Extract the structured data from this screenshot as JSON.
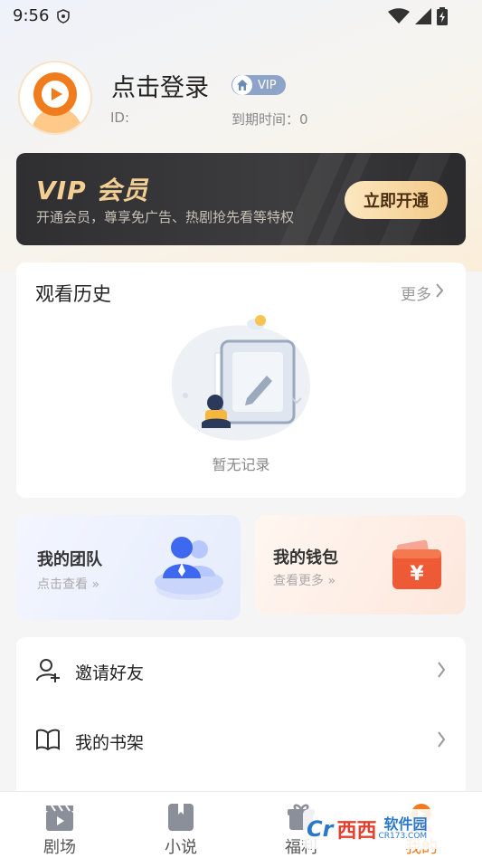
{
  "status_bar": {
    "time": "9:56"
  },
  "profile": {
    "login_text": "点击登录",
    "vip_badge": "VIP",
    "id_label": "ID:",
    "expire_label": "到期时间：0"
  },
  "vip_card": {
    "title": "VIP 会员",
    "subtitle": "开通会员，尊享免广告、热剧抢先看等特权",
    "button": "立即开通"
  },
  "history": {
    "title": "观看历史",
    "more": "更多",
    "empty_text": "暂无记录"
  },
  "team": {
    "title": "我的团队",
    "subtitle": "点击查看 »"
  },
  "wallet": {
    "title": "我的钱包",
    "subtitle": "查看更多 »"
  },
  "menu": {
    "items": [
      {
        "label": "邀请好友",
        "icon": "add-user-icon"
      },
      {
        "label": "我的书架",
        "icon": "book-icon"
      }
    ]
  },
  "tabs": [
    {
      "label": "剧场",
      "icon": "clapperboard-icon",
      "active": false
    },
    {
      "label": "小说",
      "icon": "book-icon",
      "active": false
    },
    {
      "label": "福利",
      "icon": "gift-icon",
      "active": false
    },
    {
      "label": "我的",
      "icon": "profile-icon",
      "active": true
    }
  ],
  "colors": {
    "accent": "#f07c1e",
    "vip_gold": "#f3cf94",
    "vip_dark": "#2f2f32",
    "badge_blue": "#8da3c7"
  },
  "watermark": {
    "logo": "Cr",
    "name": "西西",
    "soft": "软件园",
    "url": "CR173.COM"
  }
}
